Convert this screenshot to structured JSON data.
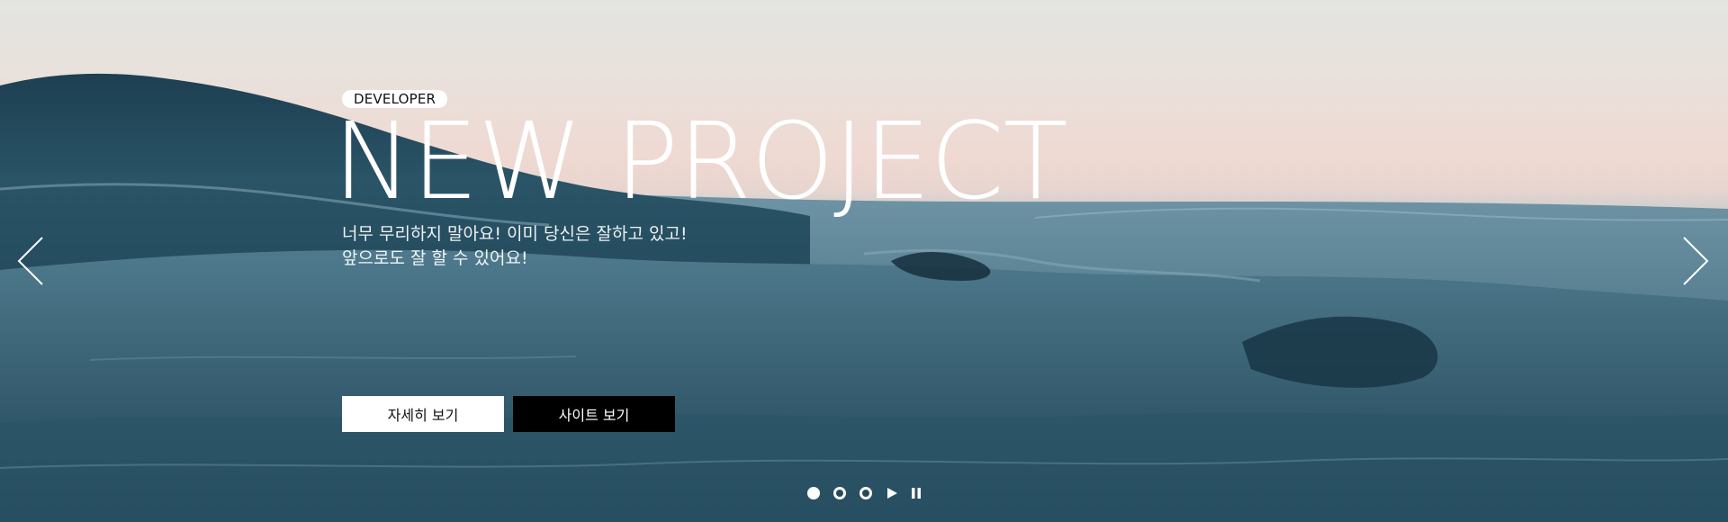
{
  "hero": {
    "badge": "DEVELOPER",
    "title": "NEW PROJECT",
    "description_line1": "너무 무리하지 말아요! 이미 당신은 잘하고 있고!",
    "description_line2": "앞으로도 잘 할 수 있어요!"
  },
  "buttons": {
    "detail_label": "자세히 보기",
    "site_label": "사이트 보기"
  },
  "navigation": {
    "prev_icon": "chevron-left-icon",
    "next_icon": "chevron-right-icon"
  },
  "pagination": {
    "slide_count": 3,
    "active_index": 0,
    "controls": [
      "play-icon",
      "pause-icon"
    ]
  },
  "colors": {
    "text": "#ffffff",
    "primary_button_bg": "#ffffff",
    "secondary_button_bg": "#000000"
  }
}
